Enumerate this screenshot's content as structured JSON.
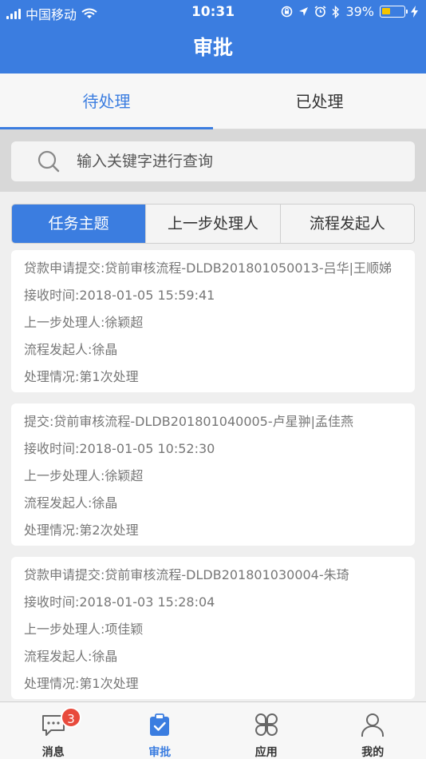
{
  "status_bar": {
    "carrier": "中国移动",
    "time": "10:31",
    "battery": "39%",
    "battery_level": 0.39
  },
  "nav": {
    "title": "审批"
  },
  "tabs": [
    {
      "label": "待处理",
      "active": true
    },
    {
      "label": "已处理",
      "active": false
    }
  ],
  "search": {
    "placeholder": "输入关键字进行查询"
  },
  "segments": [
    {
      "label": "任务主题",
      "active": true
    },
    {
      "label": "上一步处理人",
      "active": false
    },
    {
      "label": "流程发起人",
      "active": false
    }
  ],
  "cards": [
    {
      "subject": "贷款申请提交:贷前审核流程-DLDB201801050013-吕华|王顺娣",
      "received": "接收时间:2018-01-05 15:59:41",
      "prev": "上一步处理人:徐颖超",
      "initiator": "流程发起人:徐晶",
      "status": "处理情况:第1次处理"
    },
    {
      "subject": "提交:贷前审核流程-DLDB201801040005-卢星翀|孟佳燕",
      "received": "接收时间:2018-01-05 10:52:30",
      "prev": "上一步处理人:徐颖超",
      "initiator": "流程发起人:徐晶",
      "status": "处理情况:第2次处理"
    },
    {
      "subject": "贷款申请提交:贷前审核流程-DLDB201801030004-朱琦",
      "received": "接收时间:2018-01-03 15:28:04",
      "prev": "上一步处理人:项佳颖",
      "initiator": "流程发起人:徐晶",
      "status": "处理情况:第1次处理"
    }
  ],
  "bottom_nav": {
    "messages": {
      "label": "消息",
      "badge": "3",
      "icon": "chat-bubble-icon"
    },
    "approval": {
      "label": "审批",
      "icon": "clipboard-check-icon",
      "active": true
    },
    "apps": {
      "label": "应用",
      "icon": "apps-clover-icon"
    },
    "mine": {
      "label": "我的",
      "icon": "person-icon"
    }
  },
  "colors": {
    "primary": "#3b7de0",
    "badge": "#e84a3c",
    "background": "#efefef"
  }
}
